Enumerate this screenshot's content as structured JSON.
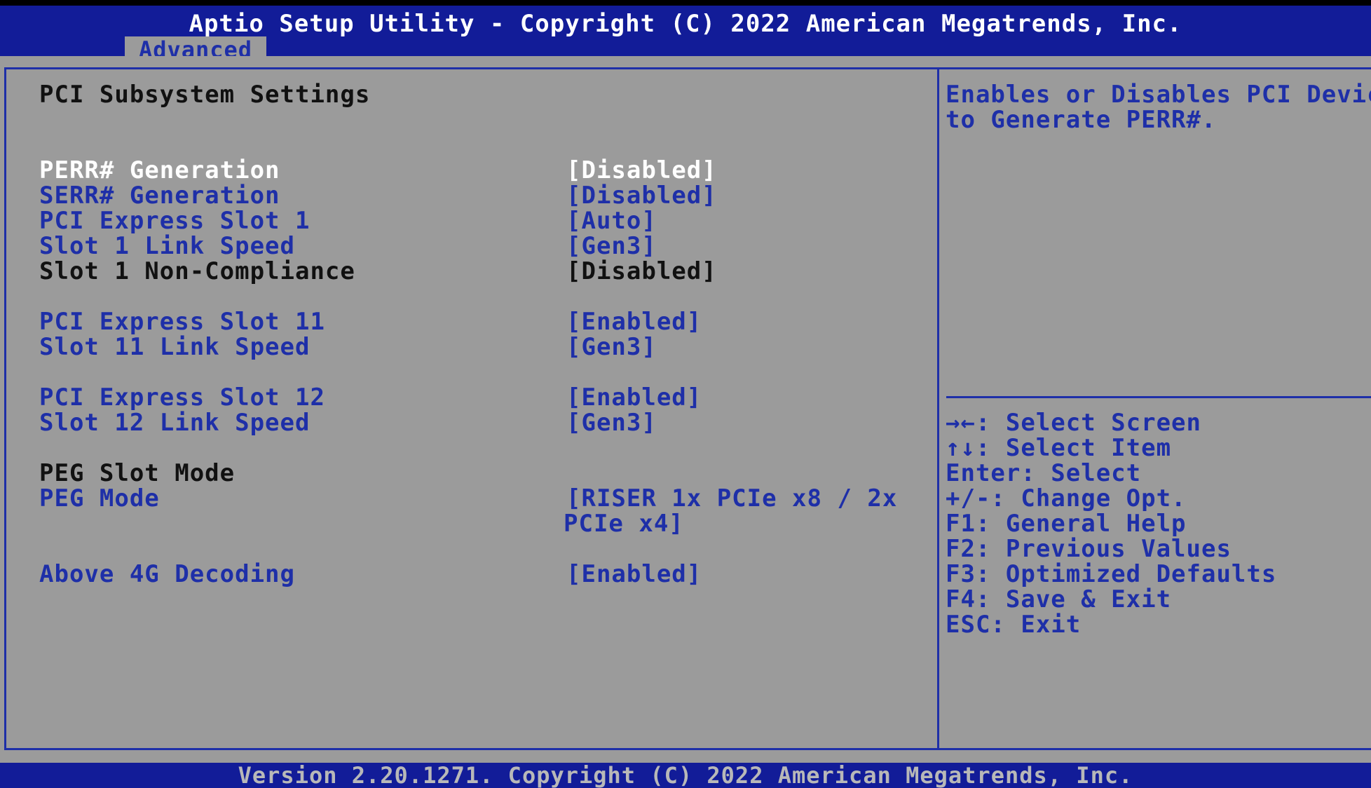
{
  "header": {
    "title": "Aptio Setup Utility - Copyright (C) 2022 American Megatrends, Inc.",
    "tab": "Advanced"
  },
  "page": {
    "heading": "PCI Subsystem Settings"
  },
  "settings": [
    {
      "label": "PERR# Generation",
      "value": "[Disabled]"
    },
    {
      "label": "SERR# Generation",
      "value": "[Disabled]"
    },
    {
      "label": "PCI Express Slot 1",
      "value": "[Auto]"
    },
    {
      "label": "Slot 1 Link Speed",
      "value": "[Gen3]"
    },
    {
      "label": "Slot 1 Non-Compliance",
      "value": "[Disabled]"
    },
    {
      "label": "PCI Express Slot 11",
      "value": "[Enabled]"
    },
    {
      "label": "Slot 11 Link Speed",
      "value": "[Gen3]"
    },
    {
      "label": "PCI Express Slot 12",
      "value": "[Enabled]"
    },
    {
      "label": "Slot 12 Link Speed",
      "value": "[Gen3]"
    },
    {
      "label": "PEG Slot Mode"
    },
    {
      "label": "PEG Mode",
      "value": "[RISER 1x PCIe x8 / 2x",
      "value_line2": "PCIe x4]"
    },
    {
      "label": "Above 4G Decoding",
      "value": "[Enabled]"
    }
  ],
  "help": {
    "description_line1": "Enables or Disables PCI Device",
    "description_line2": "to Generate PERR#.",
    "keys": [
      "→←: Select Screen",
      "↑↓: Select Item",
      "Enter: Select",
      "+/-: Change Opt.",
      "F1: General Help",
      "F2: Previous Values",
      "F3: Optimized Defaults",
      "F4: Save & Exit",
      "ESC: Exit"
    ]
  },
  "footer": {
    "text": "Version 2.20.1271. Copyright (C) 2022 American Megatrends, Inc."
  }
}
